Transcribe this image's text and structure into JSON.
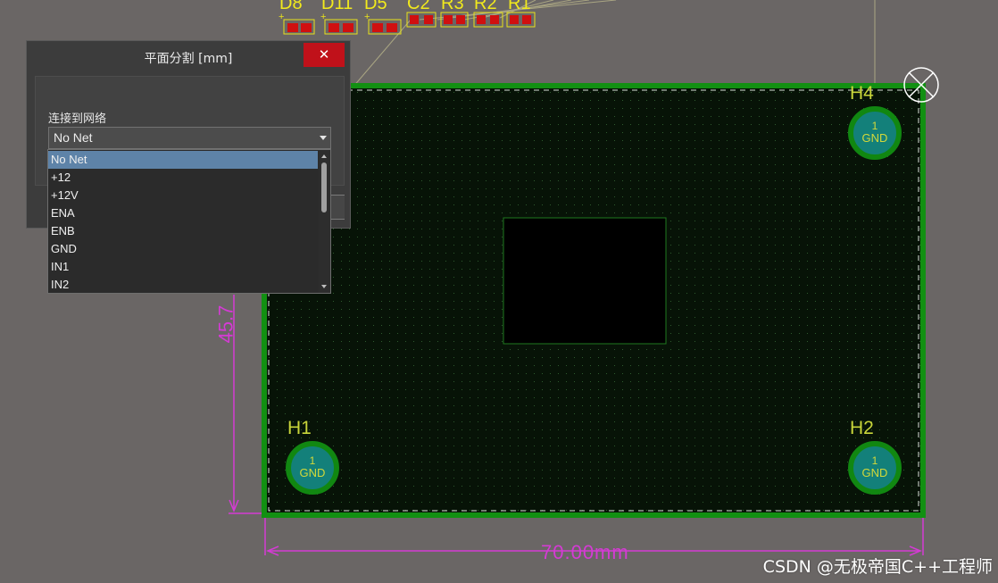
{
  "dialog": {
    "title": "平面分割 [mm]",
    "close_label": "✕",
    "net_label": "连接到网络",
    "selected_net": "No Net"
  },
  "net_options": [
    "No Net",
    "+12",
    "+12V",
    "ENA",
    "ENB",
    "GND",
    "IN1",
    "IN2"
  ],
  "components": {
    "top_labels": [
      "D8",
      "D11",
      "D5",
      "C2",
      "R3",
      "R2",
      "R1"
    ]
  },
  "mounting_holes": [
    {
      "designator": "H4",
      "pin": "1",
      "net": "GND"
    },
    {
      "designator": "H1",
      "pin": "1",
      "net": "GND"
    },
    {
      "designator": "H2",
      "pin": "1",
      "net": "GND"
    }
  ],
  "dimensions": {
    "width": "70.00mm",
    "height": "45.7"
  },
  "watermark": "CSDN @无极帝国C++工程师",
  "colors": {
    "background": "#6a6665",
    "board": "#0a1a0a",
    "board_outline": "#129012",
    "dimension": "#d43bd4",
    "silkscreen": "#f2ea1c",
    "pad": "#13807a",
    "close_button": "#c0111a",
    "selected_item": "#5e83a8"
  },
  "icons": {
    "origin_marker": "crosshair-circle-icon",
    "close": "close-icon",
    "dropdown": "chevron-down-icon"
  }
}
